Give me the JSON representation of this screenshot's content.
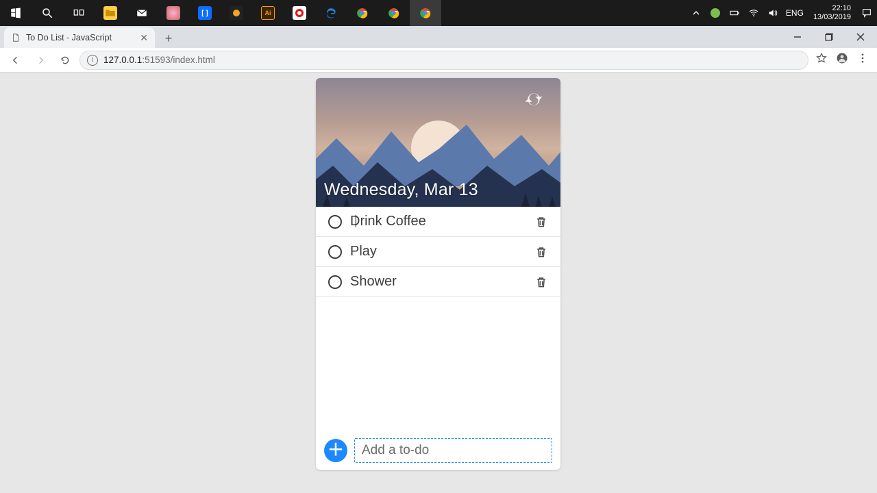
{
  "taskbar": {
    "lang": "ENG",
    "clock_time": "22:10",
    "clock_date": "13/03/2019"
  },
  "browser": {
    "tab_title": "To Do List - JavaScript",
    "url_host": "127.0.0.1",
    "url_rest": ":51593/index.html"
  },
  "app": {
    "date_label": "Wednesday, Mar 13",
    "items": [
      {
        "label": "Drink Coffee"
      },
      {
        "label": "Play"
      },
      {
        "label": "Shower"
      }
    ],
    "input_placeholder": "Add a to-do"
  }
}
